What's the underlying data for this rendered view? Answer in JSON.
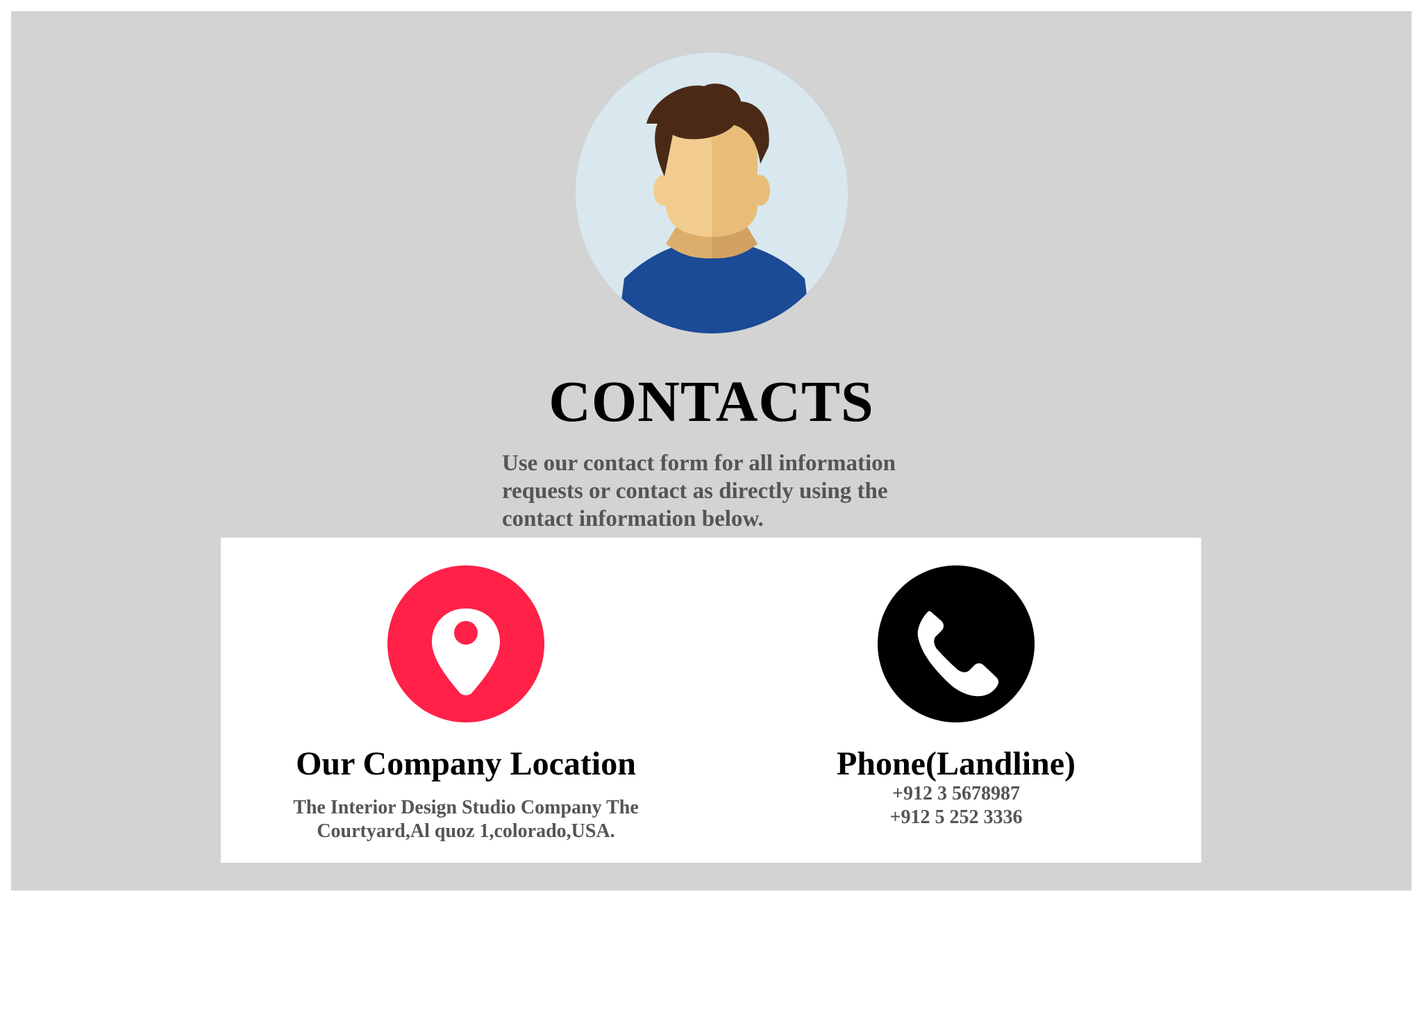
{
  "header": {
    "avatar_icon": "person-avatar-icon",
    "title": "CONTACTS",
    "intro": "Use our contact form for all information requests or contact as directly using the contact information below."
  },
  "cards": {
    "location": {
      "icon": "location-pin-icon",
      "title": "Our Company Location",
      "text": "The Interior Design Studio Company The Courtyard,Al quoz 1,colorado,USA."
    },
    "phone": {
      "icon": "phone-icon",
      "title": "Phone(Landline)",
      "numbers": [
        "+912 3 5678987",
        "+912 5 252 3336"
      ]
    }
  },
  "colors": {
    "panel_bg": "#d3d3d3",
    "card_bg": "#ffffff",
    "location_accent": "#ff2147",
    "phone_accent": "#000000",
    "body_text": "#555555"
  }
}
